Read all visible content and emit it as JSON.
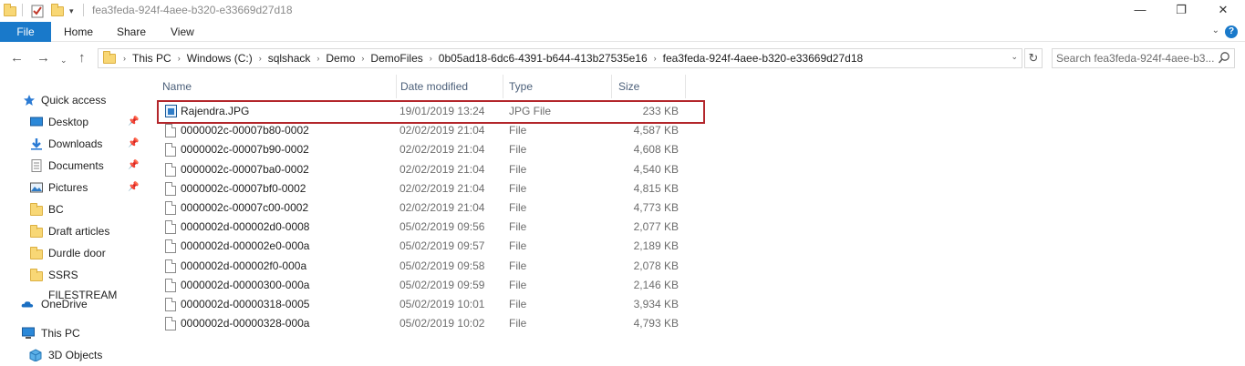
{
  "window": {
    "title": "fea3feda-924f-4aee-b320-e33669d27d18",
    "minimize_glyph": "—",
    "maximize_glyph": "❐",
    "close_glyph": "✕"
  },
  "ribbon": {
    "tabs": [
      "File",
      "Home",
      "Share",
      "View"
    ],
    "help_glyph": "?"
  },
  "address": {
    "crumbs": [
      "This PC",
      "Windows (C:)",
      "sqlshack",
      "Demo",
      "DemoFiles",
      "0b05ad18-6dc6-4391-b644-413b27535e16",
      "fea3feda-924f-4aee-b320-e33669d27d18"
    ],
    "separator": "›"
  },
  "search": {
    "placeholder": "Search fea3feda-924f-4aee-b3..."
  },
  "nav_pane": {
    "items": [
      {
        "label": "Quick access",
        "icon": "star-icon"
      },
      {
        "label": "Desktop",
        "icon": "desktop-icon",
        "pinned": true
      },
      {
        "label": "Downloads",
        "icon": "download-icon",
        "pinned": true
      },
      {
        "label": "Documents",
        "icon": "documents-icon",
        "pinned": true
      },
      {
        "label": "Pictures",
        "icon": "pictures-icon",
        "pinned": true
      },
      {
        "label": "BC",
        "icon": "folder-icon"
      },
      {
        "label": "Draft articles",
        "icon": "folder-icon"
      },
      {
        "label": "Durdle door",
        "icon": "folder-icon"
      },
      {
        "label": "SSRS FILESTREAM",
        "icon": "folder-icon"
      },
      {
        "label": "OneDrive",
        "icon": "cloud-icon"
      },
      {
        "label": "This PC",
        "icon": "computer-icon"
      },
      {
        "label": "3D Objects",
        "icon": "cube-icon"
      }
    ]
  },
  "file_list": {
    "columns": [
      "Name",
      "Date modified",
      "Type",
      "Size"
    ],
    "rows": [
      {
        "name": "Rajendra.JPG",
        "date": "19/01/2019 13:24",
        "type": "JPG File",
        "size": "233 KB",
        "icon": "image-file-icon",
        "highlighted": true
      },
      {
        "name": "0000002c-00007b80-0002",
        "date": "02/02/2019 21:04",
        "type": "File",
        "size": "4,587 KB",
        "icon": "file-icon"
      },
      {
        "name": "0000002c-00007b90-0002",
        "date": "02/02/2019 21:04",
        "type": "File",
        "size": "4,608 KB",
        "icon": "file-icon"
      },
      {
        "name": "0000002c-00007ba0-0002",
        "date": "02/02/2019 21:04",
        "type": "File",
        "size": "4,540 KB",
        "icon": "file-icon"
      },
      {
        "name": "0000002c-00007bf0-0002",
        "date": "02/02/2019 21:04",
        "type": "File",
        "size": "4,815 KB",
        "icon": "file-icon"
      },
      {
        "name": "0000002c-00007c00-0002",
        "date": "02/02/2019 21:04",
        "type": "File",
        "size": "4,773 KB",
        "icon": "file-icon"
      },
      {
        "name": "0000002d-000002d0-0008",
        "date": "05/02/2019 09:56",
        "type": "File",
        "size": "2,077 KB",
        "icon": "file-icon"
      },
      {
        "name": "0000002d-000002e0-000a",
        "date": "05/02/2019 09:57",
        "type": "File",
        "size": "2,189 KB",
        "icon": "file-icon"
      },
      {
        "name": "0000002d-000002f0-000a",
        "date": "05/02/2019 09:58",
        "type": "File",
        "size": "2,078 KB",
        "icon": "file-icon"
      },
      {
        "name": "0000002d-00000300-000a",
        "date": "05/02/2019 09:59",
        "type": "File",
        "size": "2,146 KB",
        "icon": "file-icon"
      },
      {
        "name": "0000002d-00000318-0005",
        "date": "05/02/2019 10:01",
        "type": "File",
        "size": "3,934 KB",
        "icon": "file-icon"
      },
      {
        "name": "0000002d-00000328-000a",
        "date": "05/02/2019 10:02",
        "type": "File",
        "size": "4,793 KB",
        "icon": "file-icon"
      }
    ]
  },
  "colors": {
    "accent": "#1979ca",
    "highlight_border": "#b3262b",
    "folder_fill": "#f8d775"
  }
}
